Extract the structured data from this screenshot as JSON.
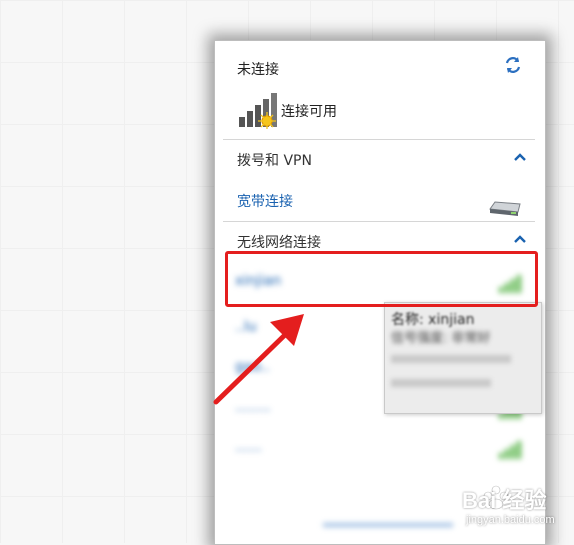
{
  "popup": {
    "title": "未连接",
    "status": "连接可用",
    "sections": {
      "dialup": {
        "label": "拨号和 VPN"
      },
      "wireless": {
        "label": "无线网络连接"
      }
    },
    "broadband_link": "宽带连接"
  },
  "wifi_list": {
    "items": [
      {
        "name": "xinjian"
      },
      {
        "name": "..lu"
      },
      {
        "name": "gao.."
      },
      {
        "name": "........"
      },
      {
        "name": "......"
      }
    ]
  },
  "tooltip": {
    "name_line": "名称: xinjian",
    "second_line": "信号强度: 非常好"
  },
  "watermark": {
    "brand": "Bai 经验",
    "url": "jingyan.baidu.com"
  },
  "colors": {
    "highlight_box": "#e41e1e",
    "link": "#1a62b0",
    "chevron": "#1a62b0"
  }
}
